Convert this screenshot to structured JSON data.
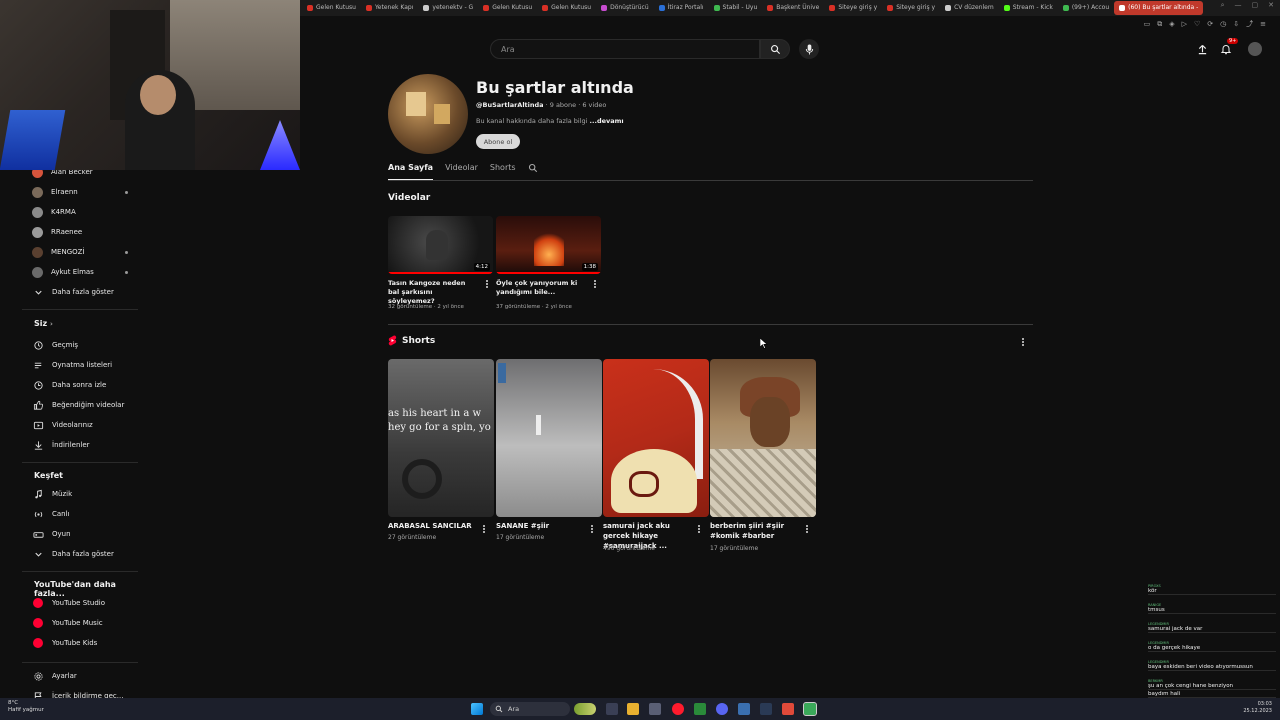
{
  "browser": {
    "tabs": [
      {
        "label": "Gelen Kutusu",
        "color": "#d93025"
      },
      {
        "label": "Yetenek Kapı",
        "color": "#d93025"
      },
      {
        "label": "yetenektv - G",
        "color": "#cccccc"
      },
      {
        "label": "Gelen Kutusu",
        "color": "#d93025"
      },
      {
        "label": "Gelen Kutusu",
        "color": "#d93025"
      },
      {
        "label": "Dönüştürücü",
        "color": "#c74ccf"
      },
      {
        "label": "İtiraz Portalı",
        "color": "#2a6fd6"
      },
      {
        "label": "Stabil - Uyu",
        "color": "#3fb950"
      },
      {
        "label": "Başkent Ünive",
        "color": "#d93025"
      },
      {
        "label": "Siteye giriş y",
        "color": "#d93025"
      },
      {
        "label": "Siteye giriş y",
        "color": "#d93025"
      },
      {
        "label": "CV düzenlem",
        "color": "#cccccc"
      },
      {
        "label": "Stream - Kick",
        "color": "#53fc18"
      },
      {
        "label": "(99+) Accou",
        "color": "#3fb950"
      },
      {
        "label": "(60) Bu şartlar altında -",
        "color": "#ffffff"
      }
    ]
  },
  "header": {
    "search_placeholder": "Ara",
    "notification_badge": "9+"
  },
  "sidebar": {
    "subscriptions": [
      {
        "label": "Alan Becker",
        "color": "#d6543c",
        "live": false
      },
      {
        "label": "Elraenn",
        "color": "#7a6a5a",
        "live": true
      },
      {
        "label": "K4RMA",
        "color": "#8a8a8a",
        "live": false
      },
      {
        "label": "RRaenee",
        "color": "#9a9a9a",
        "live": false
      },
      {
        "label": "MENGOZİ",
        "color": "#5a4030",
        "live": true
      },
      {
        "label": "Aykut Elmas",
        "color": "#6a6a6a",
        "live": true
      }
    ],
    "show_more_1": "Daha fazla göster",
    "you_heading": "Siz",
    "you_items": [
      {
        "label": "Geçmiş",
        "icon": "history-icon"
      },
      {
        "label": "Oynatma listeleri",
        "icon": "playlist-icon"
      },
      {
        "label": "Daha sonra izle",
        "icon": "clock-icon"
      },
      {
        "label": "Beğendiğim videolar",
        "icon": "like-icon"
      },
      {
        "label": "Videolarınız",
        "icon": "your-videos-icon"
      },
      {
        "label": "İndirilenler",
        "icon": "download-icon"
      }
    ],
    "explore_heading": "Keşfet",
    "explore_items": [
      {
        "label": "Müzik",
        "icon": "music-icon"
      },
      {
        "label": "Canlı",
        "icon": "live-icon"
      },
      {
        "label": "Oyun",
        "icon": "gaming-icon"
      }
    ],
    "show_more_2": "Daha fazla göster",
    "more_heading": "YouTube'dan daha fazla...",
    "more_items": [
      {
        "label": "YouTube Studio",
        "color": "#ff0033"
      },
      {
        "label": "YouTube Music",
        "color": "#ff0033"
      },
      {
        "label": "YouTube Kids",
        "color": "#ff0033"
      }
    ],
    "settings": "Ayarlar",
    "report": "İçerik bildirme geç..."
  },
  "channel": {
    "name": "Bu şartlar altında",
    "handle": "@BuSartlarAltinda",
    "stats": " · 9 abone · 6 video",
    "description": "Bu kanal hakkında daha fazla bilgi ",
    "more": "...devamı",
    "subscribe": "Abone ol"
  },
  "tabs": [
    "Ana Sayfa",
    "Videolar",
    "Shorts"
  ],
  "videos_heading": "Videolar",
  "videos": [
    {
      "title": "Tasın Kangoze neden bal şarkısını söyleyemez?",
      "meta": "32 görüntüleme · 2 yıl önce",
      "duration": "4:12",
      "progress": 1.0
    },
    {
      "title": "Öyle çok yanıyorum ki yandığımı bile...",
      "meta": "37 görüntüleme · 2 yıl önce",
      "duration": "1:38",
      "progress": 1.0
    }
  ],
  "shorts_heading": "Shorts",
  "shorts": [
    {
      "title": "ARABASAL SANCILAR",
      "meta": "27 görüntüleme",
      "overlay": "as his heart in a w\nhey go for a spin, yo"
    },
    {
      "title": "SANANE #şiir",
      "meta": "17 görüntüleme",
      "overlay": ""
    },
    {
      "title": "samurai jack aku gercek hikaye #samuraijack ...",
      "meta": "496 görüntüleme",
      "overlay": ""
    },
    {
      "title": "berberim şiiri #şiir #komik #barber",
      "meta": "17 görüntüleme",
      "overlay": ""
    }
  ],
  "chat": [
    {
      "user": "PIROXS",
      "text": "kör"
    },
    {
      "user": "RANIGE",
      "text": "tmsus"
    },
    {
      "user": "LEGENDMIR",
      "text": "samurai jack de var"
    },
    {
      "user": "LEGENDMIR",
      "text": "o da gerçek hikaye"
    },
    {
      "user": "LEGENDMIR",
      "text": "baya eskiden beri video atıyormussun"
    },
    {
      "user": "BERKMR",
      "text": "şu an çok cengi hane benziyon"
    },
    {
      "user": "",
      "text": "baydım hali"
    }
  ],
  "taskbar": {
    "weather_temp": "8°C",
    "weather_desc": "Hafif yağmur",
    "search": "Ara",
    "time": "03:03",
    "date": "25.12.2023"
  }
}
